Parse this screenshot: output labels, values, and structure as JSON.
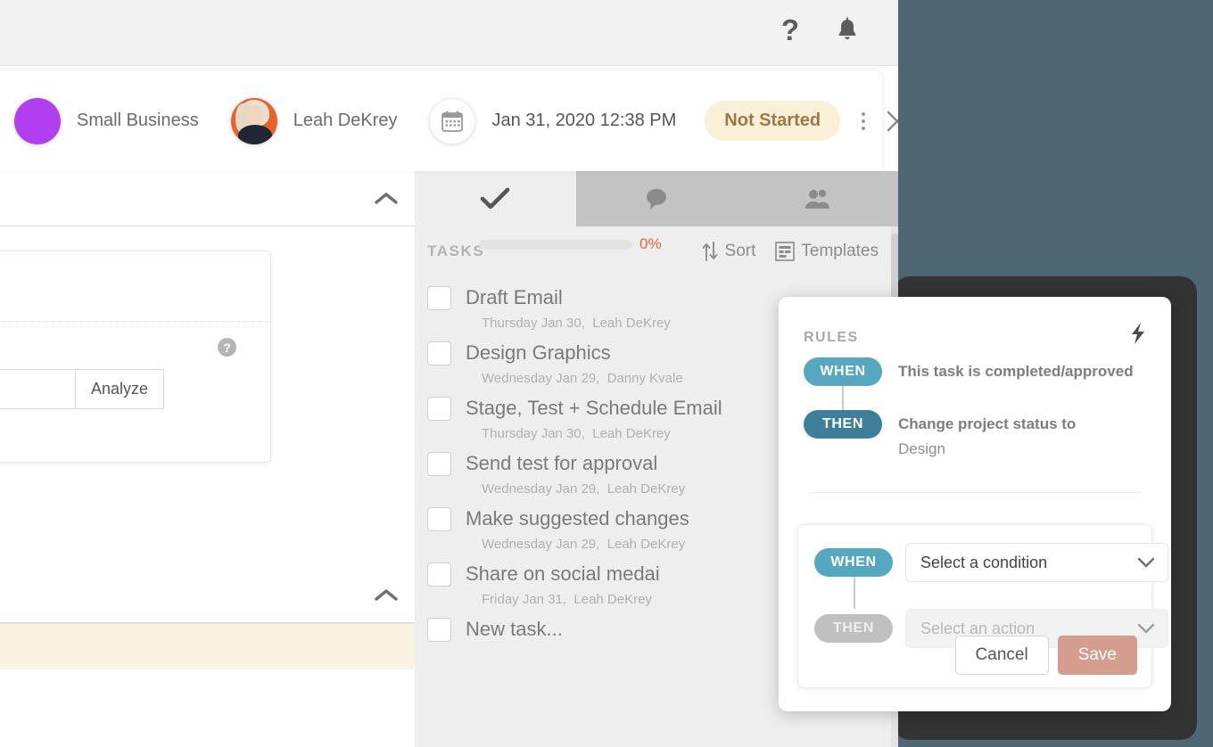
{
  "topbar": {
    "help_icon": "question-mark-icon",
    "bell_icon": "bell-icon"
  },
  "detail_header": {
    "workspace_name": "Small Business",
    "workspace_color": "#b13ef0",
    "assignee_name": "Leah DeKrey",
    "calendar_icon": "calendar-icon",
    "due_date": "Jan 31, 2020 12:38 PM",
    "status_label": "Not Started",
    "status_bg": "#faf0d7",
    "status_color": "#9b7b3f",
    "more_icon": "kebab-menu-icon",
    "close_icon": "close-icon"
  },
  "left_panel": {
    "collapse_icon": "chevron-up-icon",
    "help_badge": "?",
    "analyze_input_value": "",
    "analyze_button_label": "Analyze"
  },
  "tasks_panel": {
    "tabs": [
      {
        "id": "tasks",
        "icon": "checkmark-icon",
        "active": true
      },
      {
        "id": "comments",
        "icon": "comment-bubble-icon",
        "active": false
      },
      {
        "id": "people",
        "icon": "people-icon",
        "active": false
      }
    ],
    "section_label": "TASKS",
    "progress_percent": "0%",
    "progress_value": 0,
    "progress_color": "#e8653a",
    "sort_label": "Sort",
    "sort_icon": "sort-arrows-icon",
    "templates_label": "Templates",
    "templates_icon": "templates-grid-icon",
    "tasks": [
      {
        "title": "Draft Email",
        "date": "Thursday Jan 30,",
        "assignee": "Leah DeKrey",
        "checked": false
      },
      {
        "title": "Design Graphics",
        "date": "Wednesday Jan 29,",
        "assignee": "Danny Kvale",
        "checked": false
      },
      {
        "title": "Stage, Test + Schedule Email",
        "date": "Thursday Jan 30,",
        "assignee": "Leah DeKrey",
        "checked": false
      },
      {
        "title": "Send test for approval",
        "date": "Wednesday Jan 29,",
        "assignee": "Leah DeKrey",
        "checked": false
      },
      {
        "title": "Make suggested changes",
        "date": "Wednesday Jan 29,",
        "assignee": "Leah DeKrey",
        "checked": false
      },
      {
        "title": "Share on social medai",
        "date": "Friday Jan 31,",
        "assignee": "Leah DeKrey",
        "checked": false
      }
    ],
    "new_task_placeholder": "New task..."
  },
  "rules_card": {
    "title": "RULES",
    "bolt_icon": "lightning-bolt-icon",
    "existing_rule": {
      "when_label": "WHEN",
      "when_text": "This task is completed/approved",
      "then_label": "THEN",
      "then_text": "Change project status to",
      "then_value": "Design"
    },
    "new_rule": {
      "when_label": "WHEN",
      "condition_placeholder": "Select a condition",
      "then_label": "THEN",
      "action_placeholder": "Select an action",
      "cancel_label": "Cancel",
      "save_label": "Save",
      "save_color": "#d49d8d"
    },
    "pill_when_color": "#56a8c0",
    "pill_then_color": "#3d7f98"
  },
  "background": {
    "page_color": "#4d6773",
    "frame_color": "#333333"
  }
}
